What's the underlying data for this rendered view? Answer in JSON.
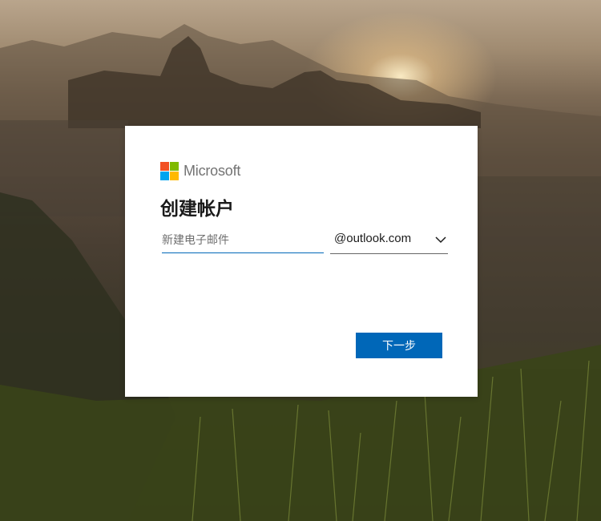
{
  "brand": {
    "name": "Microsoft",
    "logo_colors": [
      "#f25022",
      "#7fba00",
      "#00a4ef",
      "#ffb900"
    ]
  },
  "form": {
    "title": "创建帐户",
    "email_placeholder": "新建电子邮件",
    "email_value": "",
    "domain_selected": "@outlook.com",
    "next_label": "下一步"
  },
  "colors": {
    "accent": "#0067b8"
  },
  "icons": {
    "domain_dropdown": "chevron-down-icon"
  }
}
